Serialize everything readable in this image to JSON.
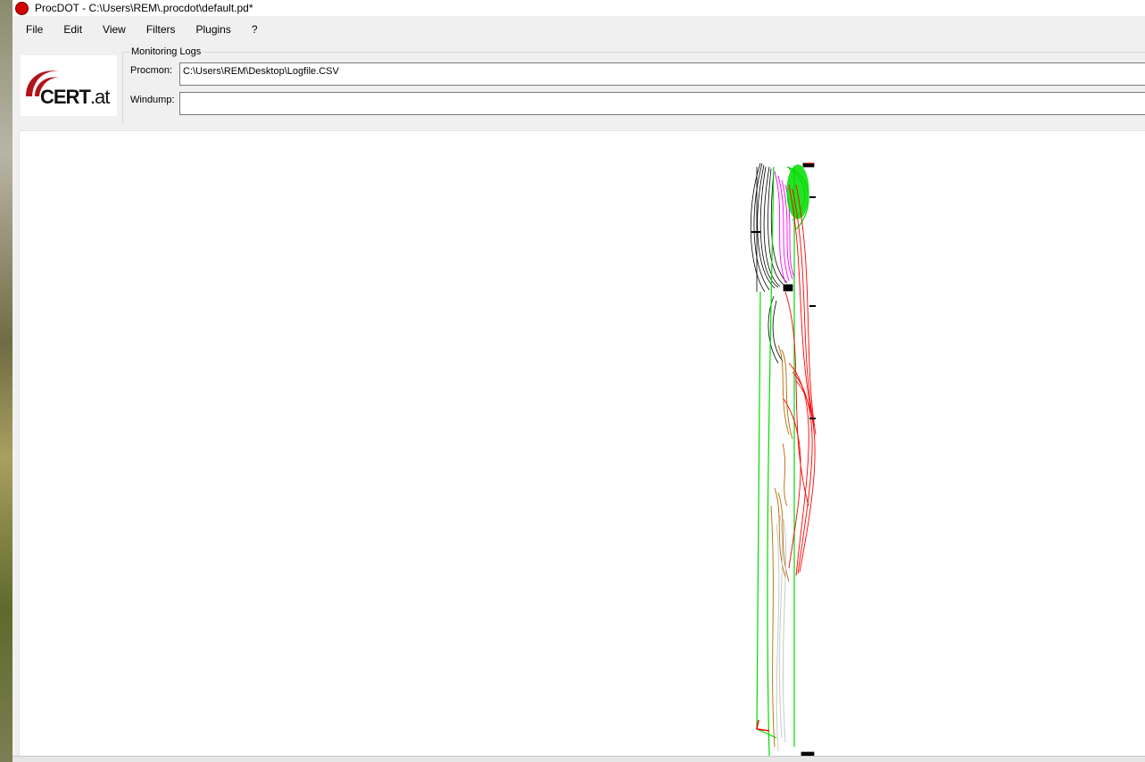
{
  "window": {
    "title": "ProcDOT - C:\\Users\\REM\\.procdot\\default.pd*",
    "app_icon": "procdot-red-dot-icon"
  },
  "menu": {
    "items": [
      "File",
      "Edit",
      "View",
      "Filters",
      "Plugins",
      "?"
    ]
  },
  "logo": {
    "main": "CERT",
    "suffix": ".at",
    "accent_color": "#b3121b"
  },
  "monitoring": {
    "legend": "Monitoring Logs",
    "procmon_label": "Procmon:",
    "procmon_value": "C:\\Users\\REM\\Desktop\\Logfile.CSV",
    "windump_label": "Windump:",
    "windump_value": ""
  },
  "graph": {
    "colors": {
      "process": "#000000",
      "file": "#ff0000",
      "registry": "#b36b00",
      "thread": "#ff00ff",
      "network": "#00dd00",
      "other": "#c8c8c8"
    }
  }
}
